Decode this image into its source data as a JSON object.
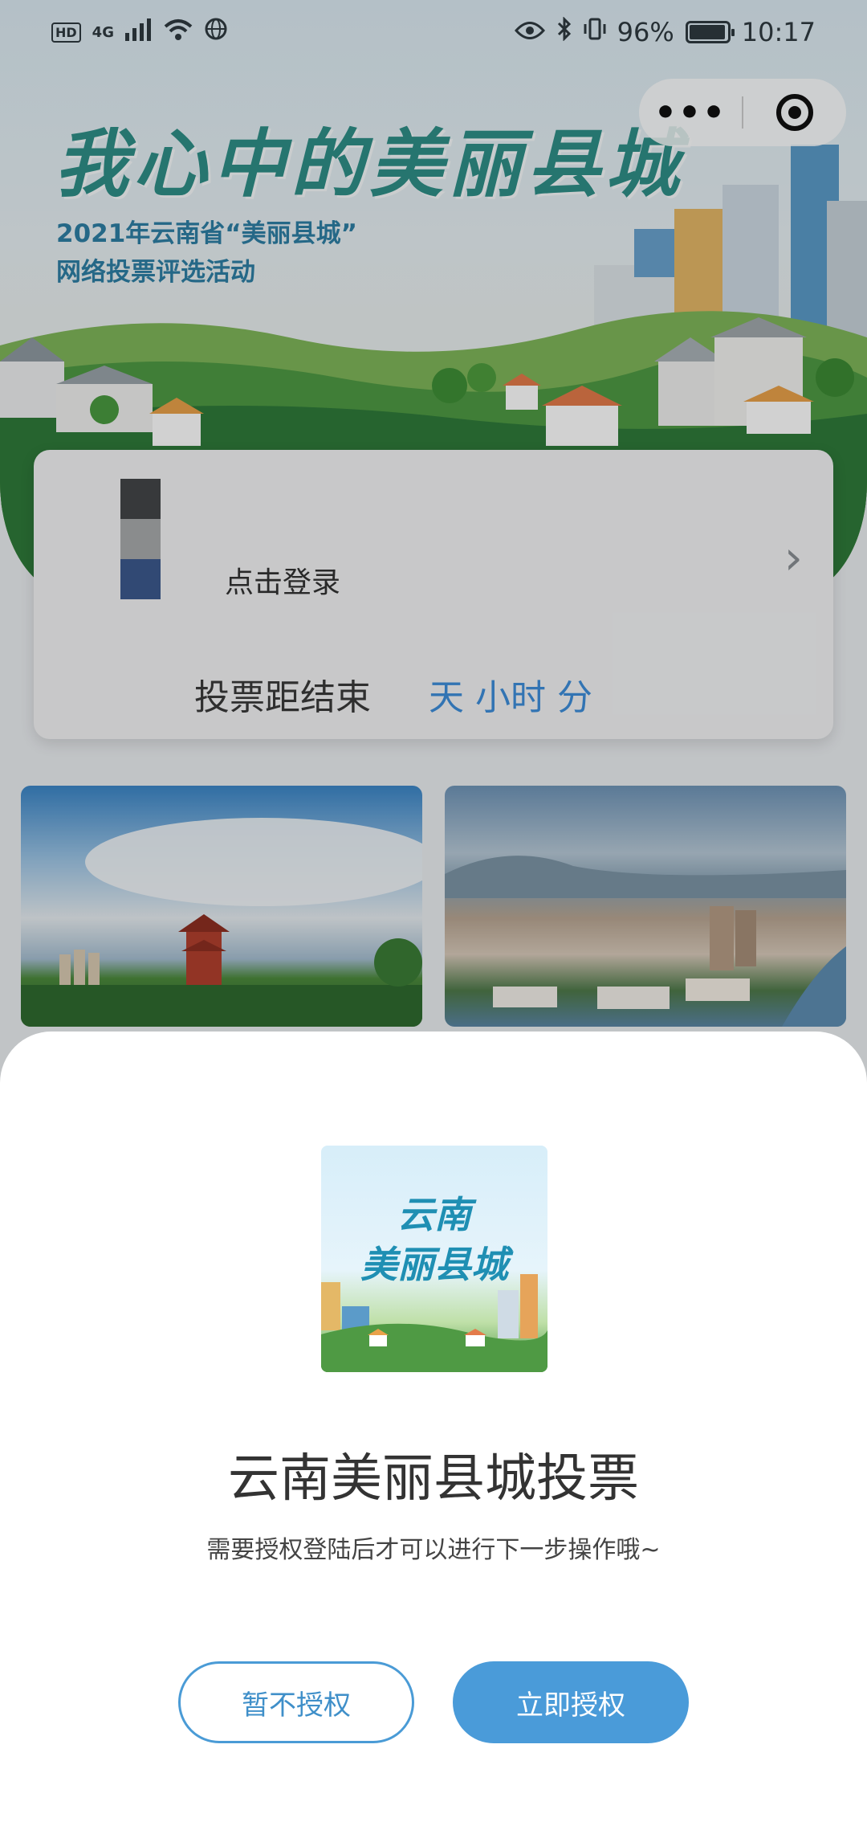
{
  "status_bar": {
    "badge": "HD",
    "network": "4G",
    "battery": "96%",
    "battery_level": 0.96,
    "time": "10:17"
  },
  "capsule": {
    "more_label": "•••",
    "close_icon": "target-ring-icon"
  },
  "hero": {
    "title": "我心中的美丽县城",
    "subtitle_line1": "2021年云南省“美丽县城”",
    "subtitle_line2": "网络投票评选活动"
  },
  "login_card": {
    "login_text": "点击登录",
    "countdown_label": "投票距结束",
    "countdown_value": "天 小时 分"
  },
  "auth_sheet": {
    "logo_line1": "云南",
    "logo_line2": "美丽县城",
    "title": "云南美丽县城投票",
    "description": "需要授权登陆后才可以进行下一步操作哦~",
    "deny_label": "暂不授权",
    "allow_label": "立即授权"
  },
  "colors": {
    "accent": "#4a9bd9",
    "countdown": "#3e8edb",
    "hero_title": "#2f8f88"
  }
}
